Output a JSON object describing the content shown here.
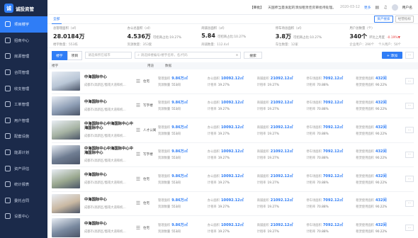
{
  "app": {
    "name": "诚投资管",
    "logo_char": "诚"
  },
  "sidebar": {
    "items": [
      {
        "label": "项目楼宇",
        "icon": "building-icon",
        "active": true
      },
      {
        "label": "招商中心",
        "icon": "target-icon"
      },
      {
        "label": "房源管理",
        "icon": "house-icon"
      },
      {
        "label": "合同管理",
        "icon": "contract-icon"
      },
      {
        "label": "收支管理",
        "icon": "wallet-icon"
      },
      {
        "label": "工单管理",
        "icon": "ticket-icon"
      },
      {
        "label": "用户管理",
        "icon": "user-icon"
      },
      {
        "label": "配套设施",
        "icon": "facility-icon"
      },
      {
        "label": "能源计划",
        "icon": "energy-icon"
      },
      {
        "label": "资产评估",
        "icon": "asset-icon"
      },
      {
        "label": "统计报表",
        "icon": "chart-icon"
      },
      {
        "label": "委托合同",
        "icon": "entrust-icon"
      },
      {
        "label": "设置中心",
        "icon": "settings-icon"
      }
    ]
  },
  "topbar": {
    "notice_tag": "【审批】",
    "notice_text": "天国师当量发起的添加租赁佳房审批待处理。",
    "notice_date": "2020-03-12",
    "more": "更多",
    "user": "用户名"
  },
  "tabs": {
    "all": "全部",
    "buttons": [
      "资产搜索",
      "经营指标"
    ]
  },
  "stats": [
    {
      "label": "总管理面积（㎡）",
      "value": "28.0184万",
      "extra": "",
      "sub": [
        "楼宇数量：553栋"
      ]
    },
    {
      "label": "办公总面积（㎡）",
      "value": "4.536万",
      "extra": "可招商占比:19.27%",
      "sub": [
        "资源数量：353套"
      ]
    },
    {
      "label": "商铺总面积（㎡）",
      "value": "5.84",
      "extra": "可招商占比:10.27%",
      "sub": [
        "商铺数量：112.4㎡"
      ]
    },
    {
      "label": "停车场总面积（㎡）",
      "value": "3.8万",
      "extra": "可招商占比:10.27%",
      "sub": [
        "车位数量：12家"
      ]
    },
    {
      "label": "用户总数量（个）",
      "value": "340个",
      "extra": "环比上月度",
      "extra_red": "-0.19%▼",
      "sub": [
        "企业用户：290个",
        "个人用户：50个"
      ]
    }
  ],
  "toolbar": {
    "seg": [
      "楼宇",
      "项目"
    ],
    "city_placeholder": "请选择所在城市",
    "search_placeholder": "请选择楼编号/楼宇名称，名/代码",
    "query": "搜索",
    "add": "+ 添加",
    "more": "···"
  },
  "table": {
    "headers": {
      "name": "楼宇",
      "use": "用途",
      "data": "数据"
    },
    "rows": [
      {
        "name": "中海国际中心",
        "address": "成都市/高新区/蜀南大道和机…",
        "use": "住宅",
        "thumb": "#b9c6d6",
        "m1": [
          "管理面积",
          "9.86万㎡"
        ],
        "m2": [
          "办公面积",
          "10092.12㎡"
        ],
        "m3": [
          "商铺面积",
          "21092.12㎡"
        ],
        "m4": [
          "停车场面积",
          "7092.12㎡"
        ],
        "m5": [
          "租赁使用面积",
          "432间"
        ],
        "s1": [
          "资源数量",
          "553间"
        ],
        "s2": [
          "计租率",
          "19.27%"
        ],
        "s3": [
          "计租率",
          "19.27%"
        ],
        "s4": [
          "计租率",
          "70.88%"
        ],
        "s5": [
          "租赁使用面积",
          "90.22%"
        ]
      },
      {
        "name": "中海国际中心",
        "address": "成都市/高新区/蜀南大道和机…",
        "use": "写字楼",
        "thumb": "#8f9fb6",
        "m1": [
          "管理面积",
          "9.86万㎡"
        ],
        "m2": [
          "办公面积",
          "10092.12㎡"
        ],
        "m3": [
          "商铺面积",
          "21092.12㎡"
        ],
        "m4": [
          "停车场面积",
          "7092.12㎡"
        ],
        "m5": [
          "租赁使用面积",
          "432间"
        ],
        "s1": [
          "资源数量",
          "553间"
        ],
        "s2": [
          "计租率",
          "19.27%"
        ],
        "s3": [
          "计租率",
          "19.27%"
        ],
        "s4": [
          "计租率",
          "70.88%"
        ],
        "s5": [
          "租赁使用面积",
          "90.22%"
        ]
      },
      {
        "name": "中海国际中心中海国际中心中海国际中心",
        "address": "成都市/高新区/蜀南大道和机…",
        "use": "人才公寓",
        "thumb": "#a6b3a3",
        "m1": [
          "管理面积",
          "9.86万㎡"
        ],
        "m2": [
          "办公面积",
          "10092.12㎡"
        ],
        "m3": [
          "商铺面积",
          "21092.12㎡"
        ],
        "m4": [
          "停车场面积",
          "7092.12㎡"
        ],
        "m5": [
          "租赁使用面积",
          "432间"
        ],
        "s1": [
          "资源数量",
          "553间"
        ],
        "s2": [
          "计租率",
          "19.27%"
        ],
        "s3": [
          "计租率",
          "19.27%"
        ],
        "s4": [
          "计租率",
          "70.88%"
        ],
        "s5": [
          "租赁使用面积",
          "90.22%"
        ]
      },
      {
        "name": "中海国际中心中海国际中心中海国际中心",
        "address": "成都市/高新区/蜀南大道和机…",
        "use": "写字楼",
        "thumb": "#6f7d92",
        "m1": [
          "管理面积",
          "9.86万㎡"
        ],
        "m2": [
          "办公面积",
          "10092.12㎡"
        ],
        "m3": [
          "商铺面积",
          "21092.12㎡"
        ],
        "m4": [
          "停车场面积",
          "7092.12㎡"
        ],
        "m5": [
          "租赁使用面积",
          "432间"
        ],
        "s1": [
          "资源数量",
          "553间"
        ],
        "s2": [
          "计租率",
          "19.27%"
        ],
        "s3": [
          "计租率",
          "19.27%"
        ],
        "s4": [
          "计租率",
          "70.88%"
        ],
        "s5": [
          "租赁使用面积",
          "90.22%"
        ]
      },
      {
        "name": "中海国际中心",
        "address": "成都市/高新区/蜀南大道和机…",
        "use": "住宅",
        "thumb": "#9aa88f",
        "m1": [
          "管理面积",
          "9.86万㎡"
        ],
        "m2": [
          "办公面积",
          "10092.12㎡"
        ],
        "m3": [
          "商铺面积",
          "21092.12㎡"
        ],
        "m4": [
          "停车场面积",
          "7092.12㎡"
        ],
        "m5": [
          "租赁使用面积",
          "432间"
        ],
        "s1": [
          "资源数量",
          "553间"
        ],
        "s2": [
          "计租率",
          "19.27%"
        ],
        "s3": [
          "计租率",
          "19.27%"
        ],
        "s4": [
          "计租率",
          "70.88%"
        ],
        "s5": [
          "租赁使用面积",
          "90.22%"
        ]
      },
      {
        "name": "中海国际中心",
        "address": "成都市/高新区/蜀南大道和机…",
        "use": "住宅",
        "thumb": "#c9b8a2",
        "m1": [
          "管理面积",
          "9.86万㎡"
        ],
        "m2": [
          "办公面积",
          "10092.12㎡"
        ],
        "m3": [
          "商铺面积",
          "21092.12㎡"
        ],
        "m4": [
          "停车场面积",
          "7092.12㎡"
        ],
        "m5": [
          "租赁使用面积",
          "432间"
        ],
        "s1": [
          "资源数量",
          "553间"
        ],
        "s2": [
          "计租率",
          "19.27%"
        ],
        "s3": [
          "计租率",
          "19.27%"
        ],
        "s4": [
          "计租率",
          "70.88%"
        ],
        "s5": [
          "租赁使用面积",
          "90.22%"
        ]
      },
      {
        "name": "中海国际中心",
        "address": "成都市/高新区/蜀南大道和机…",
        "use": "住宅",
        "thumb": "#7a8aa0",
        "m1": [
          "管理面积",
          "9.86万㎡"
        ],
        "m2": [
          "办公面积",
          "10092.12㎡"
        ],
        "m3": [
          "商铺面积",
          "21092.12㎡"
        ],
        "m4": [
          "停车场面积",
          "7092.12㎡"
        ],
        "m5": [
          "租赁使用面积",
          "432间"
        ],
        "s1": [
          "资源数量",
          "553间"
        ],
        "s2": [
          "计租率",
          "19.27%"
        ],
        "s3": [
          "计租率",
          "19.27%"
        ],
        "s4": [
          "计租率",
          "70.88%"
        ],
        "s5": [
          "租赁使用面积",
          "90.22%"
        ]
      }
    ]
  }
}
